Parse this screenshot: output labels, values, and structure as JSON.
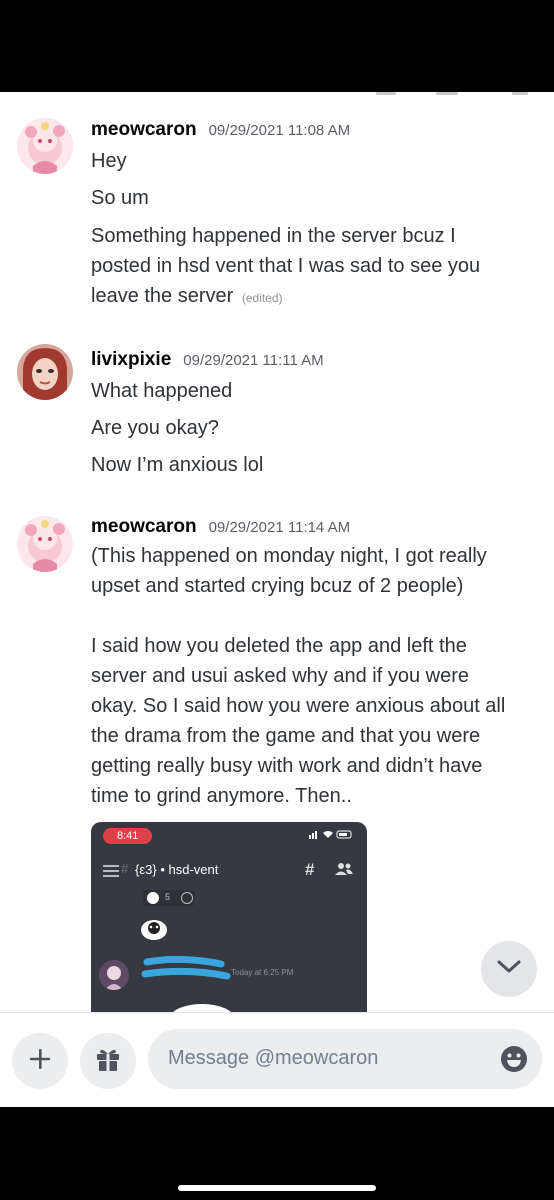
{
  "messages": [
    {
      "username": "meowcaron",
      "timestamp": "09/29/2021 11:08 AM",
      "lines": [
        "Hey",
        "So um",
        "Something happened in the server bcuz I",
        "posted in hsd vent that I was sad to see you",
        "leave the server"
      ],
      "edited_label": "(edited)"
    },
    {
      "username": "livixpixie",
      "timestamp": "09/29/2021 11:11 AM",
      "lines": [
        "What happened",
        "Are you okay?",
        "Now I’m anxious lol"
      ]
    },
    {
      "username": "meowcaron",
      "timestamp": "09/29/2021 11:14 AM",
      "lines": [
        "(This happened on monday night, I got really",
        "upset and started crying bcuz of 2 people)",
        "I said how you deleted the app and left the",
        "server and usui asked why and if you were",
        "okay. So I said how you were anxious about all",
        "the drama from the game and that you were",
        "getting really busy with work and didn’t have",
        "time to grind anymore. Then.."
      ]
    }
  ],
  "attachment": {
    "time": "8:41",
    "channel": "{ε3} • hsd-vent",
    "reaction_count": "5",
    "message_time": "Today at 6:25 PM"
  },
  "composer": {
    "placeholder": "Message @meowcaron"
  },
  "icons": {
    "add": "plus-icon",
    "gift": "gift-icon",
    "emoji": "emoji-icon",
    "scroll": "chevron-down-icon"
  }
}
